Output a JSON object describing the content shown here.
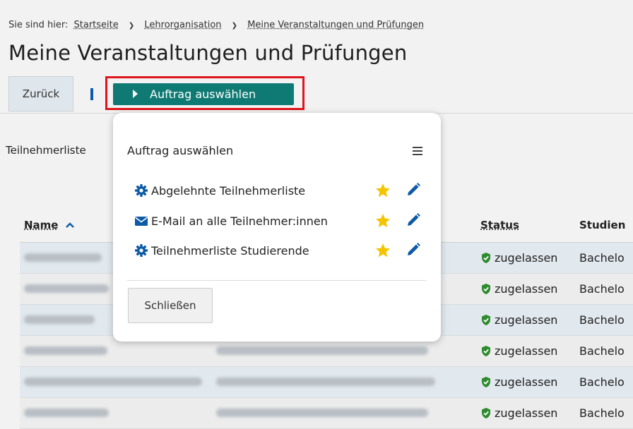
{
  "breadcrumb": {
    "prefix": "Sie sind hier:",
    "items": [
      "Startseite",
      "Lehrorganisation",
      "Meine Veranstaltungen und Prüfungen"
    ]
  },
  "page_title": "Meine Veranstaltungen und Prüfungen",
  "toolbar": {
    "back_label": "Zurück",
    "primary_label": "Auftrag auswählen"
  },
  "section_label": "Teilnehmerliste",
  "table": {
    "headers": {
      "name": "Name",
      "status": "Status",
      "study": "Studien"
    },
    "rows": [
      {
        "status": "zugelassen",
        "study": "Bachelo"
      },
      {
        "status": "zugelassen",
        "study": "Bachelo"
      },
      {
        "status": "zugelassen",
        "study": "Bachelo"
      },
      {
        "status": "zugelassen",
        "study": "Bachelo"
      },
      {
        "status": "zugelassen",
        "study": "Bachelo"
      },
      {
        "status": "zugelassen",
        "study": "Bachelo"
      }
    ]
  },
  "popover": {
    "title": "Auftrag auswählen",
    "items": [
      {
        "label": "Abgelehnte Teilnehmerliste",
        "icon": "gear-icon"
      },
      {
        "label": "E-Mail an alle Teilnehmer:innen",
        "icon": "envelope-icon"
      },
      {
        "label": "Teilnehmerliste Studierende",
        "icon": "gear-icon"
      }
    ],
    "close_label": "Schließen"
  },
  "colors": {
    "primary": "#0f7a74",
    "highlight": "#e0141b",
    "icon_blue": "#0d5aa7",
    "status_green": "#2e8b2e",
    "star": "#f5c400"
  }
}
